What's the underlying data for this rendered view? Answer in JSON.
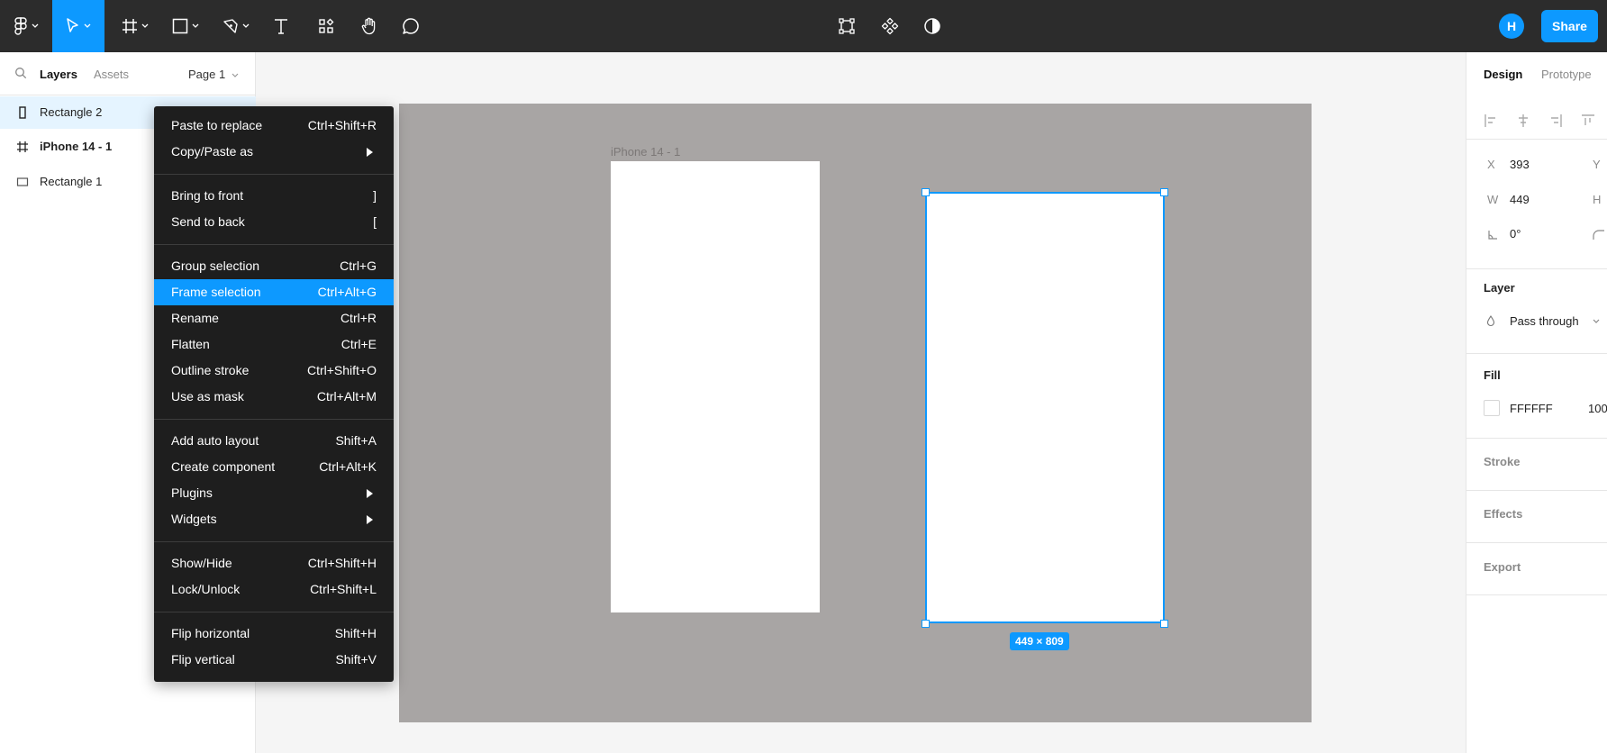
{
  "toolbar": {
    "user_initial": "H",
    "share_label": "Share",
    "accent": "#0d99ff"
  },
  "left_panel": {
    "tabs": {
      "layers": "Layers",
      "assets": "Assets"
    },
    "page_selector": "Page 1",
    "layers": [
      {
        "name": "Rectangle 2",
        "icon": "vertical-rectangle-icon",
        "selected": true
      },
      {
        "name": "iPhone 14 - 1",
        "icon": "frame-hash-icon",
        "selected": false
      },
      {
        "name": "Rectangle 1",
        "icon": "rectangle-icon",
        "selected": false
      }
    ]
  },
  "canvas": {
    "frame_label": "iPhone 14 - 1",
    "selection_size": "449 × 809",
    "frame_color": "#a8a5a4"
  },
  "context_menu": {
    "items": [
      {
        "label": "Paste to replace",
        "shortcut": "Ctrl+Shift+R"
      },
      {
        "label": "Copy/Paste as",
        "submenu": true
      },
      {
        "label": "Bring to front",
        "shortcut": "]"
      },
      {
        "label": "Send to back",
        "shortcut": "["
      },
      {
        "label": "Group selection",
        "shortcut": "Ctrl+G"
      },
      {
        "label": "Frame selection",
        "shortcut": "Ctrl+Alt+G",
        "highlighted": true
      },
      {
        "label": "Rename",
        "shortcut": "Ctrl+R"
      },
      {
        "label": "Flatten",
        "shortcut": "Ctrl+E"
      },
      {
        "label": "Outline stroke",
        "shortcut": "Ctrl+Shift+O"
      },
      {
        "label": "Use as mask",
        "shortcut": "Ctrl+Alt+M"
      },
      {
        "label": "Add auto layout",
        "shortcut": "Shift+A"
      },
      {
        "label": "Create component",
        "shortcut": "Ctrl+Alt+K"
      },
      {
        "label": "Plugins",
        "submenu": true
      },
      {
        "label": "Widgets",
        "submenu": true
      },
      {
        "label": "Show/Hide",
        "shortcut": "Ctrl+Shift+H"
      },
      {
        "label": "Lock/Unlock",
        "shortcut": "Ctrl+Shift+L"
      },
      {
        "label": "Flip horizontal",
        "shortcut": "Shift+H"
      },
      {
        "label": "Flip vertical",
        "shortcut": "Shift+V"
      }
    ]
  },
  "right_panel": {
    "tabs": {
      "design": "Design",
      "prototype": "Prototype"
    },
    "x_label": "X",
    "x_value": "393",
    "y_label": "Y",
    "w_label": "W",
    "w_value": "449",
    "h_label": "H",
    "rotation_value": "0°",
    "layer_section": "Layer",
    "blend_mode": "Pass through",
    "fill_section": "Fill",
    "fill_hex": "FFFFFF",
    "fill_opacity": "100",
    "stroke_section": "Stroke",
    "effects_section": "Effects",
    "export_section": "Export"
  }
}
